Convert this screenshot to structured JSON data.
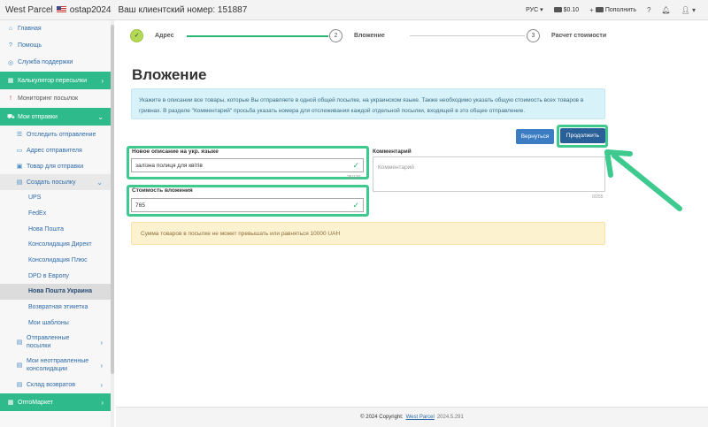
{
  "topbar": {
    "brand": "West Parcel",
    "username": "ostap2024",
    "client_number": "Ваш клиентский номер: 151887",
    "lang": "РУС",
    "balance": "$0.10",
    "topup": "Пополнить",
    "help": "?"
  },
  "sidebar": {
    "items": [
      {
        "label": "Главная"
      },
      {
        "label": "Помощь"
      },
      {
        "label": "Служба поддержки"
      },
      {
        "label": "Калькулятор пересылки"
      },
      {
        "label": "Мониторинг посылок"
      },
      {
        "label": "Мои отправки"
      },
      {
        "label": "Отследить отправление"
      },
      {
        "label": "Адрес отправителя"
      },
      {
        "label": "Товар для отправки"
      },
      {
        "label": "Создать посылку"
      },
      {
        "label": "UPS"
      },
      {
        "label": "FedEx"
      },
      {
        "label": "Нова Пошта"
      },
      {
        "label": "Консолидация Директ"
      },
      {
        "label": "Консолидация Плюс"
      },
      {
        "label": "DPD в Европу"
      },
      {
        "label": "Нова Пошта Украина"
      },
      {
        "label": "Возвратная этикетка"
      },
      {
        "label": "Мои шаблоны"
      },
      {
        "label": "Отправленные посылки"
      },
      {
        "label": "Мои неотправленные консолидации"
      },
      {
        "label": "Склад возвратов"
      },
      {
        "label": "ОптоМаркет"
      }
    ]
  },
  "steps": [
    {
      "num": "✓",
      "label": "Адрес"
    },
    {
      "num": "2",
      "label": "Вложение"
    },
    {
      "num": "3",
      "label": "Расчет стоимости"
    }
  ],
  "page": {
    "title": "Вложение",
    "info": "Укажите в описании все товары, которые Вы отправляете в одной общей посылке, на украинском языке. Также необходимо указать общую стоимость всех товаров в гривнах. В разделе \"Комментарий\" просьба указать номера для отслеживания каждой отдельной посылки, входящей в это общее отправление.",
    "back_label": "Вернуться",
    "next_label": "Продолжить",
    "desc_label": "Новое описание на укр. языке",
    "desc_value": "залізна полиця для квітів",
    "desc_counter": "25/120",
    "comment_label": "Комментарий",
    "comment_placeholder": "Комментарий",
    "comment_counter": "0/255",
    "cost_label": "Стоимость вложения",
    "cost_value": "765",
    "warning": "Сумма товаров в посылке не может превышать или равняться 10000 UAH"
  },
  "footer": {
    "copyright": "© 2024 Copyright:",
    "link": "West Parcel",
    "version": "2024.5.291"
  }
}
